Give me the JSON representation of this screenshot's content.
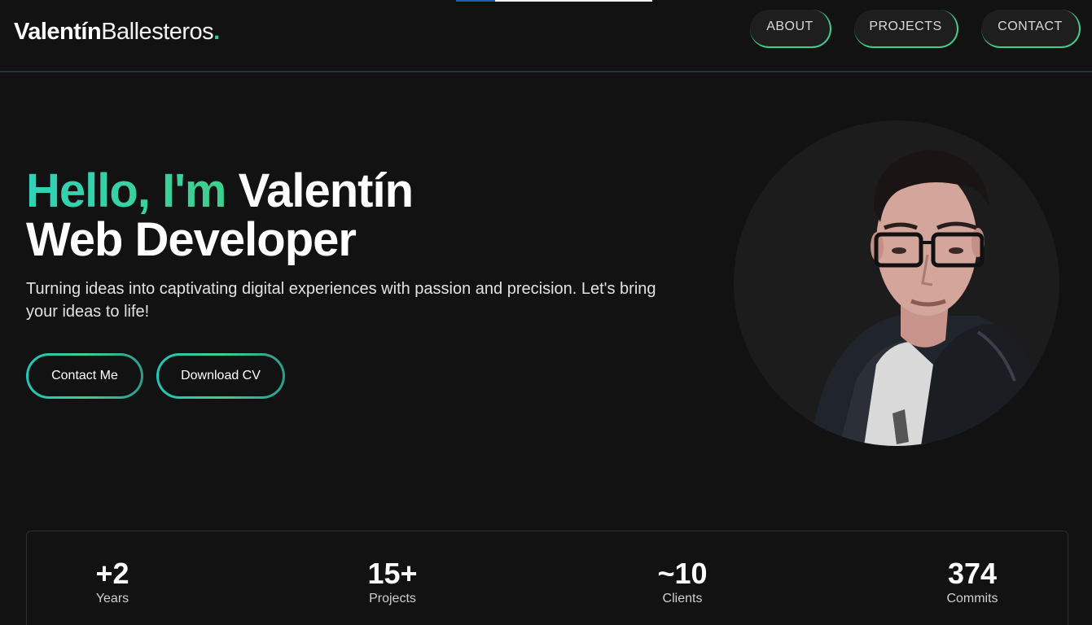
{
  "header": {
    "logo_first": "Valentín",
    "logo_last": "Ballesteros",
    "logo_dot": ".",
    "nav": [
      {
        "label": "ABOUT"
      },
      {
        "label": "PROJECTS"
      },
      {
        "label": "CONTACT"
      }
    ]
  },
  "hero": {
    "greeting": "Hello, I'm",
    "name": "Valentín",
    "role": "Web Developer",
    "subtitle": "Turning ideas into captivating digital experiences with passion and precision. Let's bring your ideas to life!",
    "buttons": {
      "contact": "Contact Me",
      "cv": "Download CV"
    }
  },
  "stats": [
    {
      "value": "+2",
      "label": "Years"
    },
    {
      "value": "15+",
      "label": "Projects"
    },
    {
      "value": "~10",
      "label": "Clients"
    },
    {
      "value": "374",
      "label": "Commits"
    }
  ],
  "colors": {
    "background": "#121212",
    "accent": "#3ecf8e",
    "accent_teal": "#2fd3b8",
    "border": "#2e2e2e"
  },
  "icons": {
    "portrait": "profile-photo"
  },
  "scroll_progress": 0.2
}
